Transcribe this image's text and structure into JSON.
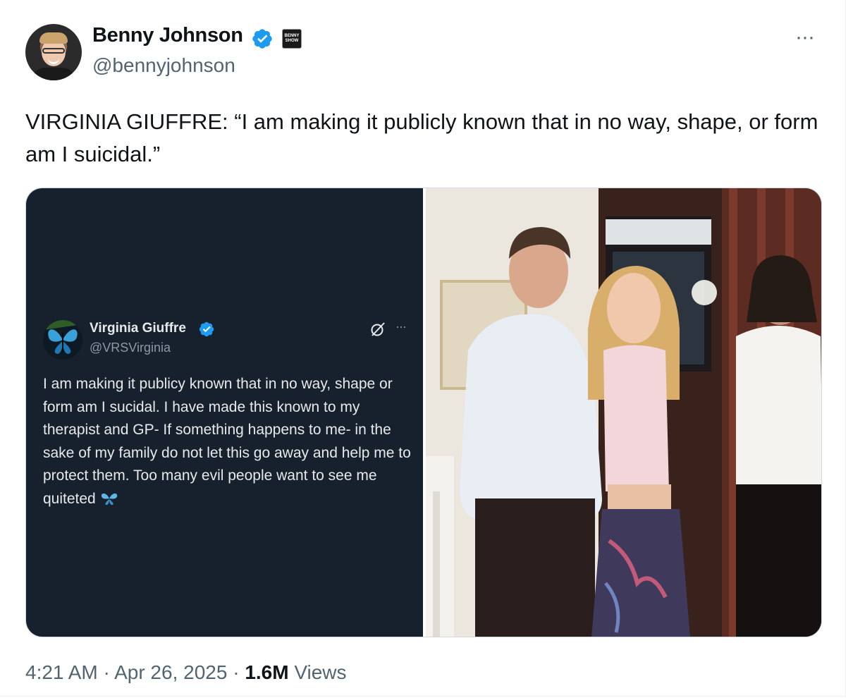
{
  "author": {
    "name": "Benny Johnson",
    "handle": "@bennyjohnson",
    "affiliate_badge": "BENNY SHOW",
    "verified_icon": "verified-badge-icon"
  },
  "more_label": "···",
  "tweet": {
    "text": "VIRGINIA GIUFFRE: “I am making it publicly known that in no way, shape, or form am I suicidal.”"
  },
  "embedded": {
    "name": "Virginia Giuffre",
    "handle": "@VRSVirginia",
    "more_label": "···",
    "text": "I am making it publicy known that in no way, shape or form am I sucidal. I have made this known to my therapist and GP- If something happens to me- in the sake of my family do not let this go away and help me to protect them. Too many evil people want to see me quiteted",
    "emoji": "butterfly-icon"
  },
  "meta": {
    "time": "4:21 AM",
    "sep1": " · ",
    "date": "Apr 26, 2025",
    "sep2": " · ",
    "views_count": "1.6M",
    "views_label": " Views"
  },
  "colors": {
    "verified_blue": "#1d9bf0",
    "text_primary": "#0f1419",
    "text_secondary": "#536471",
    "embedded_bg": "#17212d"
  }
}
